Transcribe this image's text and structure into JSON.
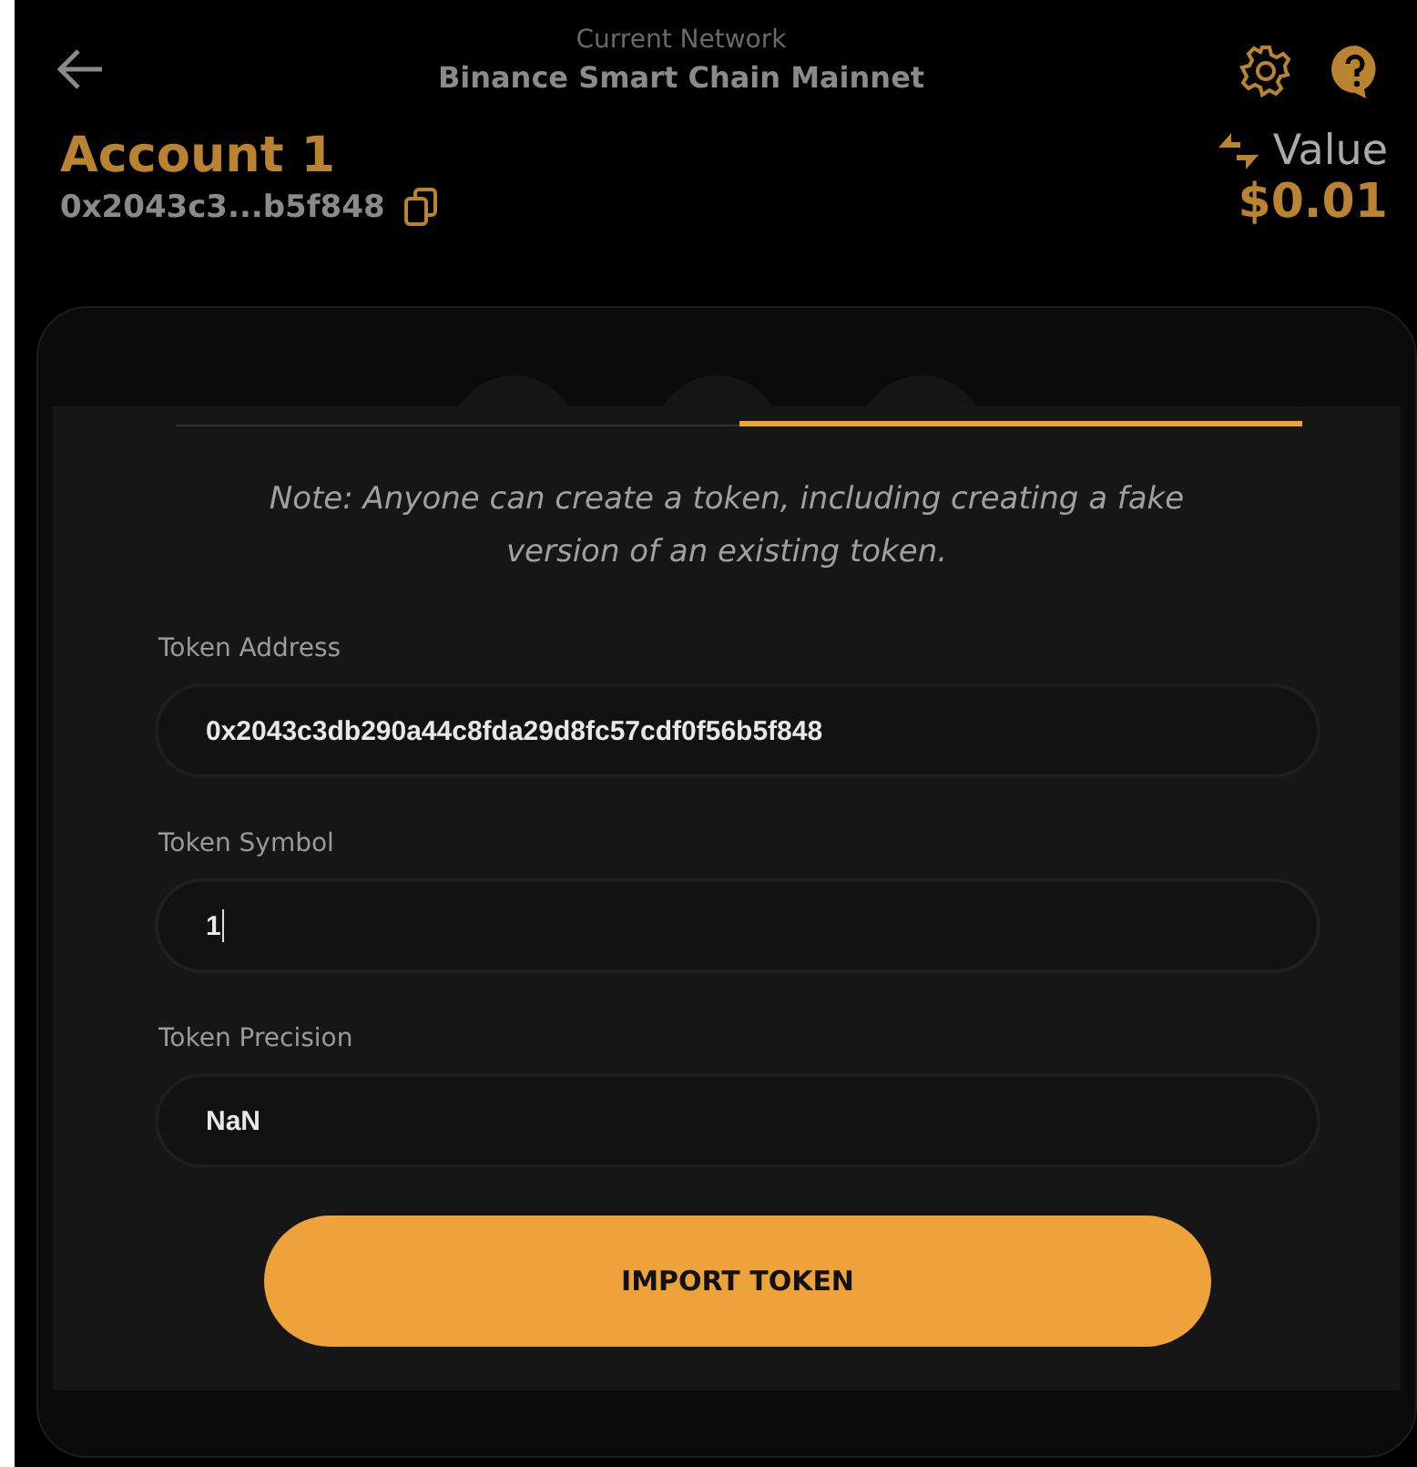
{
  "header": {
    "network_label": "Current Network",
    "network_name": "Binance Smart Chain Mainnet",
    "account_name": "Account 1",
    "account_address": "0x2043c3...b5f848",
    "value_label": "Value",
    "value_amount": "$0.01"
  },
  "tabs": [
    {
      "selected": false
    },
    {
      "selected": true
    }
  ],
  "note": "Note: Anyone can create a token, including creating a fake version of an existing token.",
  "fields": [
    {
      "label": "Token Address",
      "value": "0x2043c3db290a44c8fda29d8fc57cdf0f56b5f848",
      "focused": false
    },
    {
      "label": "Token Symbol",
      "value": "1",
      "focused": true
    },
    {
      "label": "Token Precision",
      "value": "NaN",
      "focused": false
    }
  ],
  "button": "IMPORT TOKEN"
}
